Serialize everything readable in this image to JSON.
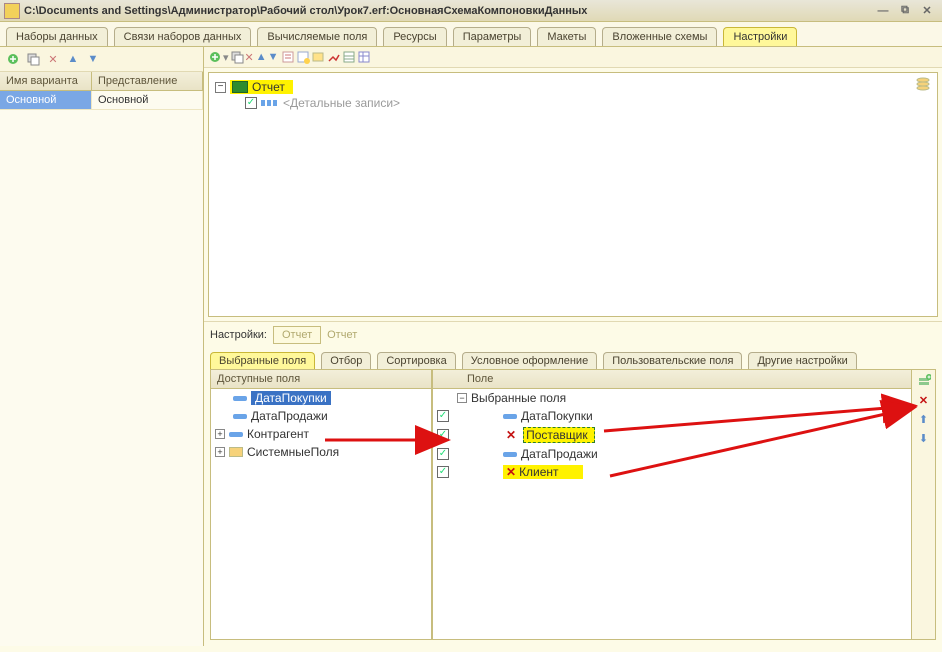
{
  "title_path": "C:\\Documents and Settings\\Администратор\\Рабочий стол\\Урок7.erf: ",
  "title_doc": "ОсновнаяСхемаКомпоновкиДанных",
  "main_tabs": [
    "Наборы данных",
    "Связи наборов данных",
    "Вычисляемые поля",
    "Ресурсы",
    "Параметры",
    "Макеты",
    "Вложенные схемы",
    "Настройки"
  ],
  "main_tab_active_index": 7,
  "left": {
    "col1": "Имя варианта",
    "col2": "Представление",
    "row1_name": "Основной",
    "row1_repr": "Основной"
  },
  "tree": {
    "root_label": "Отчет",
    "child_label": "<Детальные записи>"
  },
  "settings_label": "Настройки:",
  "settings_box1": "Отчет",
  "settings_box2": "Отчет",
  "sub_tabs": [
    "Выбранные поля",
    "Отбор",
    "Сортировка",
    "Условное оформление",
    "Пользовательские поля",
    "Другие настройки"
  ],
  "sub_tab_active_index": 0,
  "avail": {
    "header": "Доступные поля",
    "items": [
      "ДатаПокупки",
      "ДатаПродажи",
      "Контрагент",
      "СистемныеПоля"
    ]
  },
  "sel": {
    "header": "Поле",
    "root": "Выбранные поля",
    "rows": [
      {
        "label": "ДатаПокупки",
        "x": false,
        "hl": false
      },
      {
        "label": "Поставщик",
        "x": true,
        "hl": true
      },
      {
        "label": "ДатаПродажи",
        "x": false,
        "hl": false
      },
      {
        "label": "Клиент",
        "x": true,
        "hl": true
      }
    ]
  }
}
